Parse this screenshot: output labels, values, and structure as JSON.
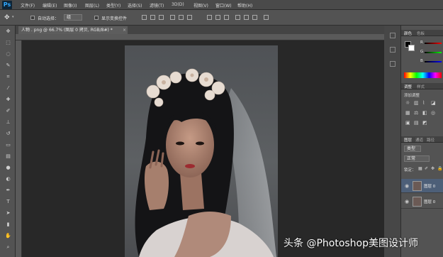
{
  "app": {
    "logo": "Ps"
  },
  "menu": [
    "文件(F)",
    "编辑(E)",
    "图像(I)",
    "图层(L)",
    "类型(Y)",
    "选择(S)",
    "滤镜(T)",
    "3D(D)",
    "视图(V)",
    "窗口(W)",
    "帮助(H)"
  ],
  "options": {
    "auto_select_label": "自动选择：",
    "auto_select_value": "组",
    "show_transform_label": "显示变换控件"
  },
  "document": {
    "tab_title": "人物 . png @ 66.7% (图层 0 拷贝, RGB/8#) *",
    "close": "×"
  },
  "panels": {
    "color_tabs": [
      "颜色",
      "色板"
    ],
    "color_channels": [
      "R",
      "G",
      "B"
    ],
    "adjust_tabs": [
      "调整",
      "样式"
    ],
    "adjust_title": "添加调整",
    "layers_tabs": [
      "图层",
      "通道",
      "路径"
    ],
    "kind_label": "类型",
    "blend_mode": "正常",
    "lock_label": "锁定：",
    "layers": [
      {
        "name": "图层 0"
      },
      {
        "name": "图层 0"
      }
    ]
  },
  "colors": {
    "foreground": "#000000",
    "background": "#ffffff",
    "accent": "#31a8ff"
  },
  "watermark": "头条 @Photoshop美图设计师"
}
